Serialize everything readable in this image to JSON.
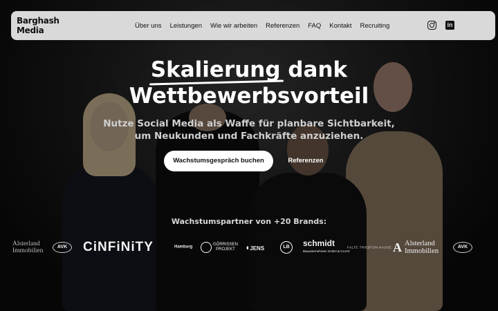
{
  "colors": {
    "navbar_bg": "#d9d9d9",
    "primary_button_bg": "#ffffff",
    "text_light": "#ffffff",
    "subline": "#cfcfcf"
  },
  "nav": {
    "logo_line1": "Barghash",
    "logo_line2": "Media",
    "links": [
      "Über uns",
      "Leistungen",
      "Wie wir arbeiten",
      "Referenzen",
      "FAQ",
      "Kontakt",
      "Recruiting"
    ],
    "social": [
      {
        "icon": "instagram-icon"
      },
      {
        "icon": "linkedin-icon",
        "glyph": "in"
      }
    ]
  },
  "hero": {
    "headline_highlight": "Skalierung",
    "headline_rest": " dank",
    "headline_line2": "Wettbewerbsvorteil",
    "subline_line1": "Nutze Social Media als Waffe für planbare Sichtbarkeit,",
    "subline_line2": "um Neukunden und Fachkräfte anzuziehen.",
    "primary_button": "Wachstumsgespräch buchen",
    "secondary_button": "Referenzen"
  },
  "partners": {
    "title": "Wachstumspartner von +20 Brands:",
    "logos": {
      "alsterland_left_1": "Alsterland",
      "alsterland_left_2": "Immobilien",
      "avk": "AVK",
      "cinfinity": "CiNFiNiTY",
      "small_brand": "Hamburg",
      "gorrissen_1": "GÖRRISSEN",
      "gorrissen_2": "PROJEKT",
      "jens": "JENS",
      "lb": "LB",
      "schmidt": "schmidt",
      "schmidt_sub": "Bauunternehmen GmbH & Co.KG",
      "tiny_brand": "FALTE TRIEBTON HAUSE",
      "alsterland_right_1": "Alsterland",
      "alsterland_right_2": "Immobilien",
      "avk_right": "AVK"
    }
  }
}
